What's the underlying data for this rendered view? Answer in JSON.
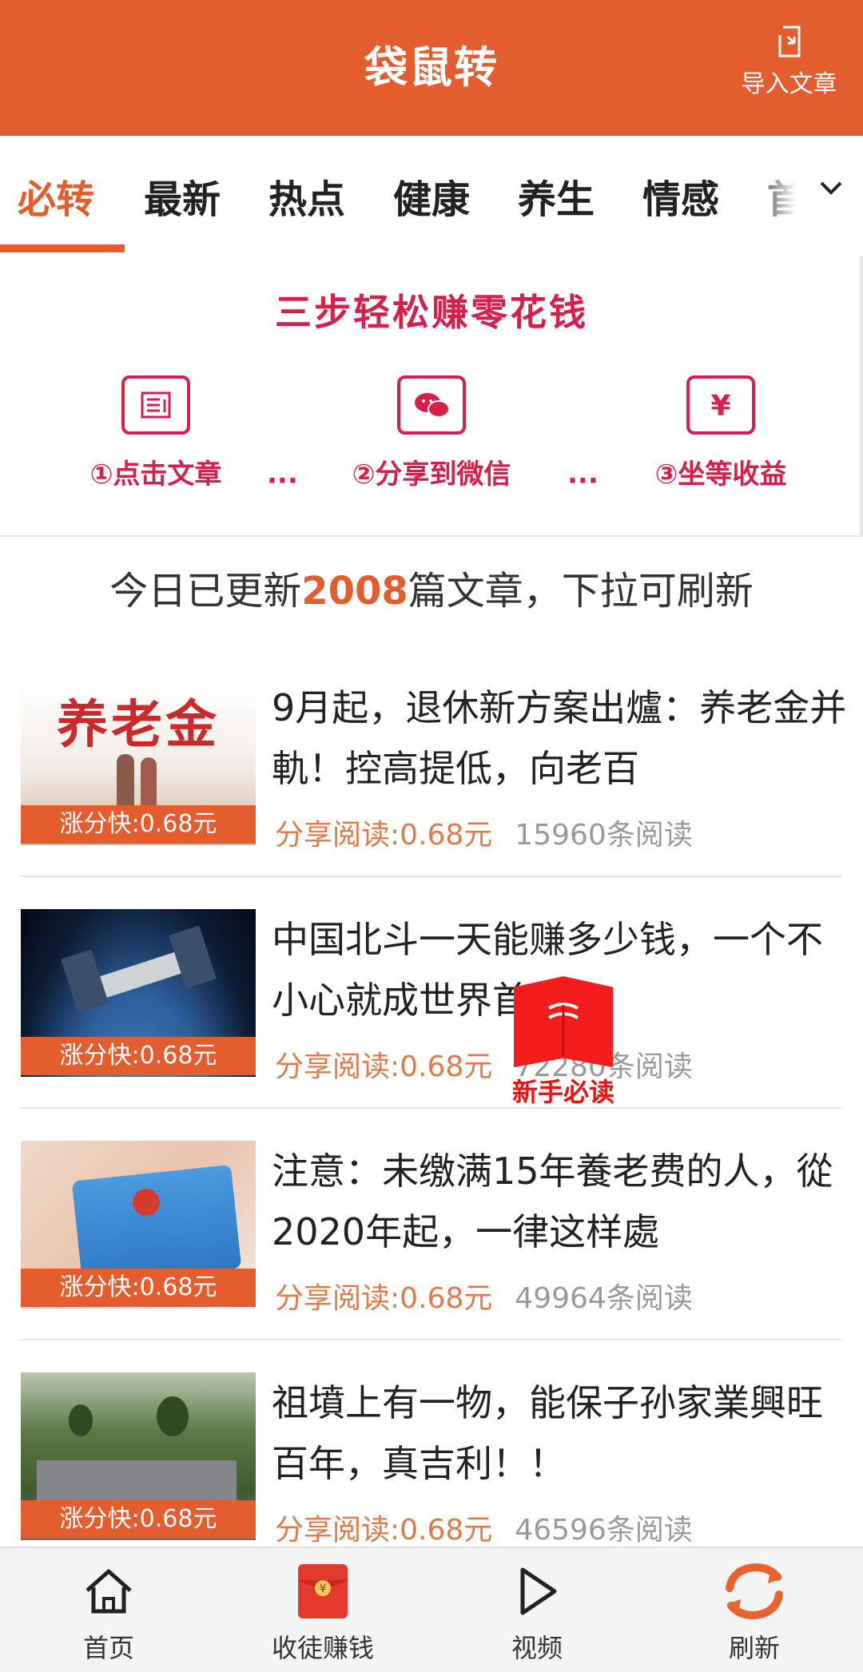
{
  "header": {
    "title": "袋鼠转",
    "import_label": "导入文章"
  },
  "tabs": [
    {
      "label": "必转",
      "active": true
    },
    {
      "label": "最新"
    },
    {
      "label": "热点"
    },
    {
      "label": "健康"
    },
    {
      "label": "养生"
    },
    {
      "label": "情感"
    },
    {
      "label": "首"
    }
  ],
  "steps": {
    "title": "三步轻松赚零花钱",
    "items": [
      {
        "label": "①点击文章",
        "icon": "article-icon"
      },
      {
        "label": "②分享到微信",
        "icon": "wechat-icon"
      },
      {
        "label": "③坐等收益",
        "icon": "yuan-icon"
      }
    ],
    "separator": "···"
  },
  "update": {
    "prefix": "今日已更新",
    "count": "2008",
    "suffix": "篇文章，下拉可刷新"
  },
  "articles": [
    {
      "headline": "9月起，退休新方案出爐：养老金并軌！控高提低，向老百",
      "badge": "涨分快:0.68元",
      "earn": "分享阅读:0.68元",
      "reads": "15960条阅读",
      "thumb_text": "养老金"
    },
    {
      "headline": "中国北斗一天能赚多少钱，一个不小心就成世界首富！",
      "badge": "涨分快:0.68元",
      "earn": "分享阅读:0.68元",
      "reads": "72280条阅读"
    },
    {
      "headline": "注意：未缴满15年養老费的人，從2020年起，一律这样處",
      "badge": "涨分快:0.68元",
      "earn": "分享阅读:0.68元",
      "reads": "49964条阅读"
    },
    {
      "headline": "祖墳上有一物，能保子孙家業興旺百年，真吉利！！",
      "badge": "涨分快:0.68元",
      "earn": "分享阅读:0.68元",
      "reads": "46596条阅读"
    }
  ],
  "guide": {
    "label": "新手必读"
  },
  "bottom_nav": [
    {
      "label": "首页",
      "icon": "home-icon"
    },
    {
      "label": "收徒赚钱",
      "icon": "red-envelope-icon"
    },
    {
      "label": "视频",
      "icon": "play-icon"
    },
    {
      "label": "刷新",
      "icon": "refresh-icon"
    }
  ],
  "colors": {
    "brand": "#e45d2e",
    "accent_red": "#d81e4a",
    "earn_text": "#e07a4a"
  }
}
